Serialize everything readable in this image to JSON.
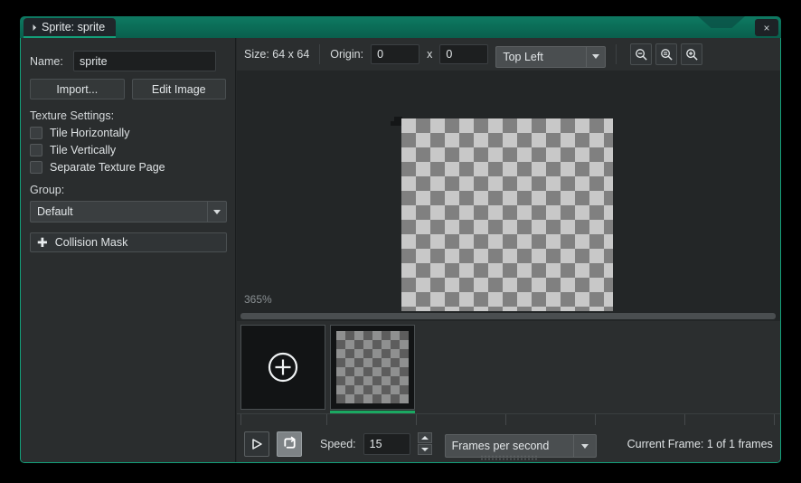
{
  "window": {
    "tab_title": "Sprite: sprite",
    "close_label": "×",
    "accent_color": "#13a07a",
    "titlebar_color": "#0b6e58"
  },
  "left_panel": {
    "name_label": "Name:",
    "name_value": "sprite",
    "name_placeholder": "sprite",
    "import_button": "Import...",
    "edit_image_button": "Edit Image",
    "texture_settings_label": "Texture Settings:",
    "checkboxes": [
      {
        "label": "Tile Horizontally",
        "checked": false
      },
      {
        "label": "Tile Vertically",
        "checked": false
      },
      {
        "label": "Separate Texture Page",
        "checked": false
      }
    ],
    "group_label": "Group:",
    "group_value": "Default",
    "collision_mask_label": "Collision Mask",
    "collision_mask_icon": "plus-icon"
  },
  "toolbar": {
    "size_text": "Size: 64 x 64",
    "origin_label": "Origin:",
    "origin_x": "0",
    "origin_y": "0",
    "origin_separator": "x",
    "origin_preset": "Top Left",
    "zoom_out_icon": "zoom-out-icon",
    "zoom_reset_icon": "zoom-reset-icon",
    "zoom_in_icon": "zoom-in-icon"
  },
  "canvas": {
    "zoom_level": "365%",
    "checker_light": "#c8c8c8",
    "checker_dark": "#808080"
  },
  "frames": {
    "add_frame_icon": "plus-circle-icon",
    "selected_index": 1,
    "selection_color": "#1aa861"
  },
  "bottom_bar": {
    "play_icon": "play-icon",
    "loop_icon": "loop-icon",
    "speed_label": "Speed:",
    "speed_value": "15",
    "speed_unit": "Frames per second",
    "current_frame_text": "Current Frame: 1 of 1 frames"
  }
}
